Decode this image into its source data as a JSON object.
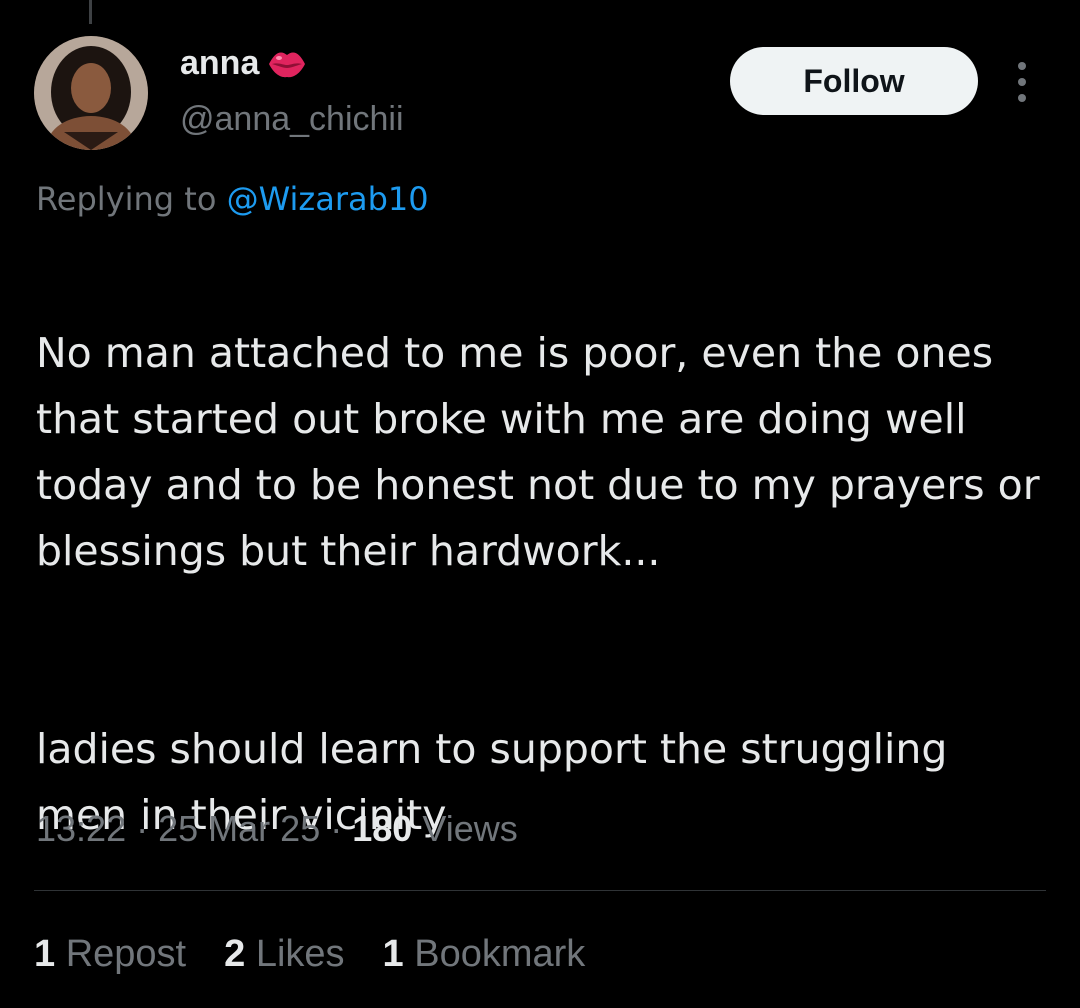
{
  "author": {
    "display_name": "anna",
    "name_emoji": "lips-icon",
    "handle": "@anna_chichii",
    "avatar": "profile-photo"
  },
  "follow_button": {
    "label": "Follow"
  },
  "more_menu": {
    "icon": "more-vertical-icon"
  },
  "reply_context": {
    "prefix": "Replying to",
    "mention": "@Wizarab10"
  },
  "tweet": {
    "paragraphs": [
      "No man attached to me is poor, even the ones that started out broke with me are doing well today and to be honest not due to my prayers or blessings but their hardwork...",
      "ladies should learn to support the struggling men in their vicinity"
    ]
  },
  "meta": {
    "time": "13:22",
    "separator": "·",
    "date": "25 Mar 25",
    "views_count": "180",
    "views_label": "Views"
  },
  "stats": {
    "reposts": {
      "count": "1",
      "label": "Repost"
    },
    "likes": {
      "count": "2",
      "label": "Likes"
    },
    "bookmarks": {
      "count": "1",
      "label": "Bookmark"
    }
  },
  "colors": {
    "background": "#000000",
    "primary_text": "#e7e9ea",
    "secondary_text": "#71767b",
    "link": "#1d9bf0",
    "divider": "#2f3336",
    "follow_bg": "#eff3f4",
    "follow_text": "#0f1419",
    "lips": "#e0245e"
  }
}
